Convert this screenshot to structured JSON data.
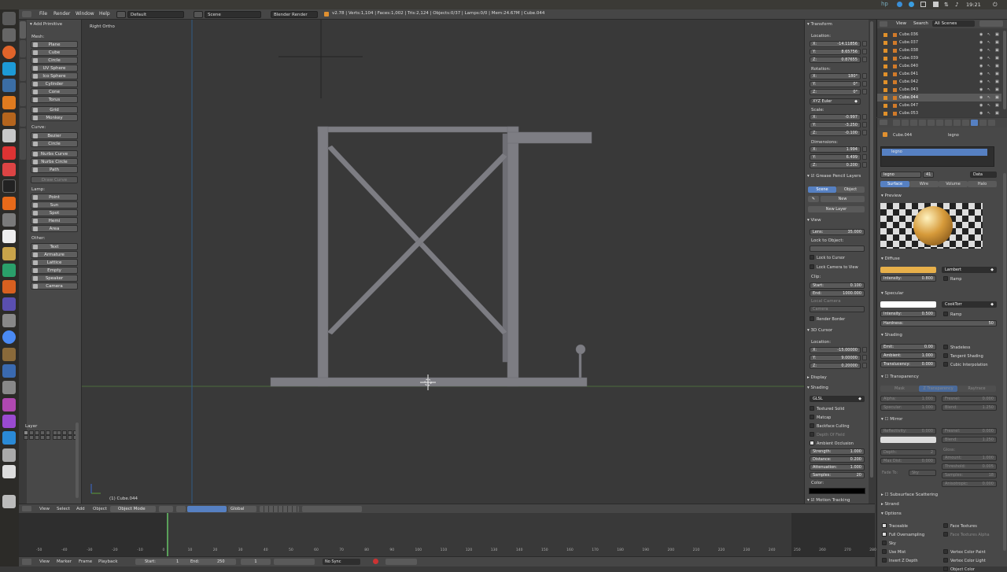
{
  "topbar": {
    "time": "19:21"
  },
  "header": {
    "menus": [
      "File",
      "Render",
      "Window",
      "Help"
    ],
    "layout": "Default",
    "scene": "Scene",
    "engine": "Blender Render",
    "stats": "v2.78 | Verts:1,104 | Faces:1,002 | Tris:2,124 | Objects:0/37 | Lamps:0/0 | Mem:24.67M | Cube.044"
  },
  "toolshelf": {
    "title": "Add Primitive",
    "mesh_label": "Mesh:",
    "mesh": [
      "Plane",
      "Cube",
      "Circle",
      "UV Sphere",
      "Ico Sphere",
      "Cylinder",
      "Cone",
      "Torus"
    ],
    "mesh2": [
      "Grid",
      "Monkey"
    ],
    "curve_label": "Curve:",
    "curve": [
      "Bezier",
      "Circle"
    ],
    "curve2": [
      "Nurbs Curve",
      "Nurbs Circle",
      "Path"
    ],
    "draw_curve": "Draw Curve",
    "lamp_label": "Lamp:",
    "lamp": [
      "Point",
      "Sun",
      "Spot",
      "Hemi",
      "Area"
    ],
    "other_label": "Other:",
    "other": [
      "Text",
      "Armature",
      "Lattice",
      "Empty",
      "Speaker",
      "Camera"
    ],
    "layer_label": "Layer",
    "tabs": [
      "Tools",
      "Create",
      "Relations",
      "Animation",
      "Physics",
      "Grease Pencil"
    ]
  },
  "viewport": {
    "view_name": "Right Ortho",
    "object_name": "(1) Cube.044"
  },
  "npanel": {
    "transform": "Transform",
    "location": "Location:",
    "loc": [
      {
        "k": "X:",
        "v": "-14.11856"
      },
      {
        "k": "Y:",
        "v": "8.65756"
      },
      {
        "k": "Z:",
        "v": "0.87655"
      }
    ],
    "rotation": "Rotation:",
    "rot": [
      {
        "k": "X:",
        "v": "180°"
      },
      {
        "k": "Y:",
        "v": "0°"
      },
      {
        "k": "Z:",
        "v": "0°"
      }
    ],
    "rot_mode": "XYZ Euler",
    "scale": "Scale:",
    "scl": [
      {
        "k": "X:",
        "v": "-0.997"
      },
      {
        "k": "Y:",
        "v": "-3.250"
      },
      {
        "k": "Z:",
        "v": "-0.100"
      }
    ],
    "dimensions": "Dimensions:",
    "dim": [
      {
        "k": "X:",
        "v": "1.994"
      },
      {
        "k": "Y:",
        "v": "6.499"
      },
      {
        "k": "Z:",
        "v": "0.200"
      }
    ],
    "grease": "Grease Pencil Layers",
    "gp_scene": "Scene",
    "gp_object": "Object",
    "gp_new": "New",
    "gp_new_layer": "New Layer",
    "view": "View",
    "lens": {
      "k": "Lens:",
      "v": "35.000"
    },
    "lock_to_object": "Lock to Object:",
    "lock_cursor": "Lock to Cursor",
    "lock_camera": "Lock Camera to View",
    "clip": "Clip:",
    "clip_start": {
      "k": "Start:",
      "v": "0.100"
    },
    "clip_end": {
      "k": "End:",
      "v": "1000.000"
    },
    "local_camera": "Local Camera",
    "camera": "Camera",
    "render_border": "Render Border",
    "cursor": "3D Cursor",
    "cursor_loc": "Location:",
    "cur": [
      {
        "k": "X:",
        "v": "-15.00000"
      },
      {
        "k": "Y:",
        "v": "9.00000"
      },
      {
        "k": "Z:",
        "v": "0.20000"
      }
    ],
    "display": "Display",
    "shading": "Shading",
    "shading_mode": "GLSL",
    "textured_solid": "Textured Solid",
    "matcap": "Matcap",
    "backface": "Backface Culling",
    "dof": "Depth Of Field",
    "ao": "Ambient Occlusion",
    "ao_fields": [
      {
        "k": "Strength:",
        "v": "1.000"
      },
      {
        "k": "Distance:",
        "v": "0.200"
      },
      {
        "k": "Attenuation:",
        "v": "1.000"
      },
      {
        "k": "Samples:",
        "v": "20"
      }
    ],
    "color": "Color:",
    "motion": "Motion Tracking"
  },
  "outliner": {
    "menus": [
      "View",
      "Search"
    ],
    "scenes": "All Scenes",
    "items": [
      "Cube.036",
      "Cube.037",
      "Cube.038",
      "Cube.039",
      "Cube.040",
      "Cube.041",
      "Cube.042",
      "Cube.043",
      "Cube.044",
      "Cube.047",
      "Cube.053"
    ]
  },
  "props": {
    "crumb_obj": "Cube.044",
    "crumb_mat": "legno",
    "mat_slot": "legno",
    "mat_name": "legno",
    "mat_users": "41",
    "data": "Data",
    "tabs": [
      "Surface",
      "Wire",
      "Volume",
      "Halo"
    ],
    "preview": "Preview",
    "diffuse": "Diffuse",
    "diffuse_shader": "Lambert",
    "diffuse_intensity": {
      "k": "Intensity:",
      "v": "0.800"
    },
    "ramp": "Ramp",
    "specular": "Specular",
    "spec_shader": "CookTorr",
    "spec_intensity": {
      "k": "Intensity:",
      "v": "0.500"
    },
    "hardness": {
      "k": "Hardness:",
      "v": "50"
    },
    "shading": "Shading",
    "emit": {
      "k": "Emit:",
      "v": "0.00"
    },
    "ambient": {
      "k": "Ambient:",
      "v": "1.000"
    },
    "translucency": {
      "k": "Translucency:",
      "v": "0.000"
    },
    "shadeless": "Shadeless",
    "tangent": "Tangent Shading",
    "cubic": "Cubic Interpolation",
    "transparency": "Transparency",
    "tr_tabs": [
      "Mask",
      "Z Transparency",
      "Raytrace"
    ],
    "alpha": {
      "k": "Alpha:",
      "v": "1.000"
    },
    "fresnel": {
      "k": "Fresnel:",
      "v": "0.000"
    },
    "specular_f": {
      "k": "Specular:",
      "v": "1.000"
    },
    "blend": {
      "k": "Blend:",
      "v": "1.250"
    },
    "mirror": "Mirror",
    "reflectivity": {
      "k": "Reflectivity:",
      "v": "0.000"
    },
    "m_fresnel": {
      "k": "Fresnel:",
      "v": "0.000"
    },
    "m_blend": {
      "k": "Blend:",
      "v": "1.250"
    },
    "depth": {
      "k": "Depth:",
      "v": "2"
    },
    "max_dist": {
      "k": "Max Dist:",
      "v": "0.000"
    },
    "fade_to": "Fade To:",
    "sky": "Sky",
    "gloss": "Gloss:",
    "amount": {
      "k": "Amount:",
      "v": "1.000"
    },
    "threshold": {
      "k": "Threshold:",
      "v": "0.005"
    },
    "samples": {
      "k": "Samples:",
      "v": "18"
    },
    "anisotropic": {
      "k": "Anisotropic:",
      "v": "0.000"
    },
    "sss": "Subsurface Scattering",
    "strand": "Strand",
    "options": "Options",
    "opt_left": [
      "Traceable",
      "Full Oversampling",
      "Sky",
      "Use Mist",
      "Invert Z Depth"
    ],
    "opt_right": [
      "Face Textures",
      "Face Textures Alpha",
      "",
      "Vertex Color Paint",
      "Vertex Color Light",
      "Object Color"
    ]
  },
  "vpheader": {
    "menus": [
      "View",
      "Select",
      "Add",
      "Object"
    ],
    "mode": "Object Mode",
    "orient": "Global"
  },
  "timeline": {
    "ticks": [
      "-50",
      "-40",
      "-30",
      "-20",
      "-10",
      "0",
      "10",
      "20",
      "30",
      "40",
      "50",
      "60",
      "70",
      "80",
      "90",
      "100",
      "110",
      "120",
      "130",
      "140",
      "150",
      "160",
      "170",
      "180",
      "190",
      "200",
      "210",
      "220",
      "230",
      "240",
      "250",
      "260",
      "270",
      "280"
    ],
    "menus": [
      "View",
      "Marker",
      "Frame",
      "Playback"
    ],
    "start": {
      "k": "Start:",
      "v": "1"
    },
    "end": {
      "k": "End:",
      "v": "250"
    },
    "frame": "1",
    "sync": "No Sync"
  },
  "colors": {
    "diffuse": "#e8b04a",
    "mesh": "#7d7d83",
    "accent": "#5680c2"
  }
}
